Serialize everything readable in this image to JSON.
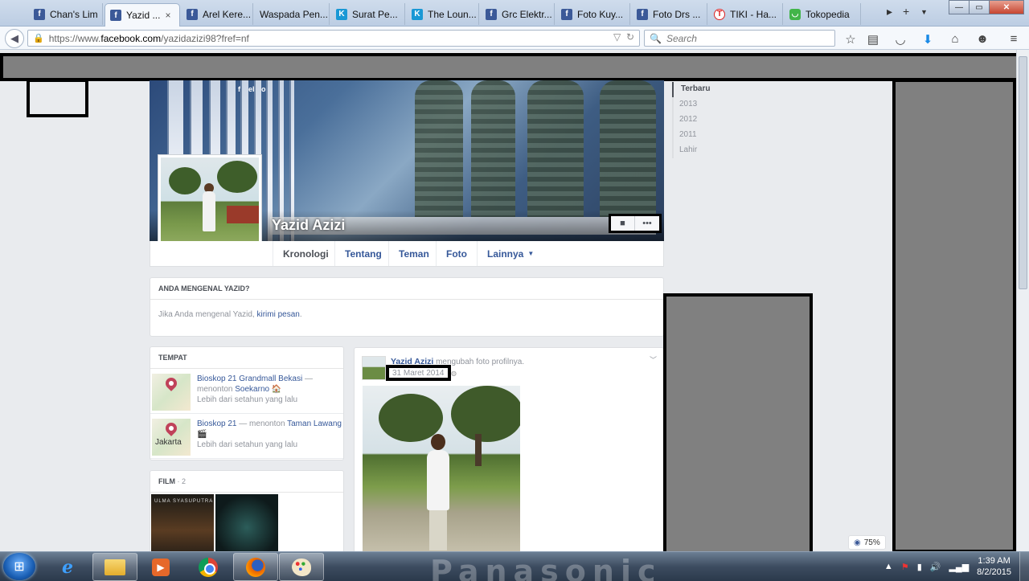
{
  "browser": {
    "tabs": [
      {
        "label": "Chan's Lim",
        "favicon": "fb",
        "active": false
      },
      {
        "label": "Yazid ...",
        "favicon": "fb",
        "active": true
      },
      {
        "label": "Arel Kere...",
        "favicon": "fb",
        "active": false
      },
      {
        "label": "Waspada Pen...",
        "favicon": "none",
        "active": false
      },
      {
        "label": "Surat Pe...",
        "favicon": "kaskus",
        "active": false
      },
      {
        "label": "The Loun...",
        "favicon": "kaskus",
        "active": false
      },
      {
        "label": "Grc Elektr...",
        "favicon": "fb",
        "active": false
      },
      {
        "label": "Foto Kuy...",
        "favicon": "fb",
        "active": false
      },
      {
        "label": "Foto Drs ...",
        "favicon": "fb",
        "active": false
      },
      {
        "label": "TIKI - Ha...",
        "favicon": "tiki",
        "active": false
      },
      {
        "label": "Tokopedia",
        "favicon": "toko",
        "active": false
      }
    ],
    "tab_close_glyph": "×",
    "new_tab_glyph": "+",
    "url": {
      "scheme": "https://www.",
      "host": "facebook.com",
      "path": "/yazidazizi98?fref=nf"
    },
    "search_placeholder": "Search",
    "window_buttons": {
      "minimize": "—",
      "maximize": "▭",
      "close": "✕"
    }
  },
  "profile": {
    "name": "Yazid Azizi",
    "cover_brand": "facebook",
    "tabs": [
      {
        "label": "Kronologi",
        "active": true
      },
      {
        "label": "Tentang",
        "active": false
      },
      {
        "label": "Teman",
        "active": false
      },
      {
        "label": "Foto",
        "active": false
      },
      {
        "label": "Lainnya",
        "active": false,
        "has_caret": true
      }
    ],
    "more_glyph": "•••",
    "camera_glyph": "■"
  },
  "year_nav": [
    "Terbaru",
    "2013",
    "2012",
    "2011",
    "Lahir"
  ],
  "know_card": {
    "header": "ANDA MENGENAL YAZID?",
    "text_before": "Jika Anda mengenal Yazid, ",
    "link": "kirimi pesan",
    "text_after": "."
  },
  "places_card": {
    "header": "TEMPAT",
    "items": [
      {
        "place": "Bioskop 21 Grandmall Bekasi",
        "dash": " — ",
        "verb": "menonton ",
        "movie": "Soekarno",
        "emoji": "🏠",
        "time": "Lebih dari setahun yang lalu",
        "map_label": ""
      },
      {
        "place": "Bioskop 21",
        "dash": " — ",
        "verb": "menonton ",
        "movie": "Taman Lawang",
        "emoji": "🎬",
        "time": "Lebih dari setahun yang lalu",
        "map_label": "Jakarta"
      }
    ]
  },
  "films_card": {
    "header": "FILM",
    "count": "· 2",
    "film1_text": "ULMA SYASUPUTRA"
  },
  "post": {
    "author": "Yazid Azizi",
    "action": " mengubah foto profilnya.",
    "time": "31 Maret 2014"
  },
  "zoom": "75%",
  "taskbar": {
    "wallpaper_text": "Panasonic",
    "time": "1:39 AM",
    "date": "8/2/2015",
    "tray_arrow": "▲"
  }
}
